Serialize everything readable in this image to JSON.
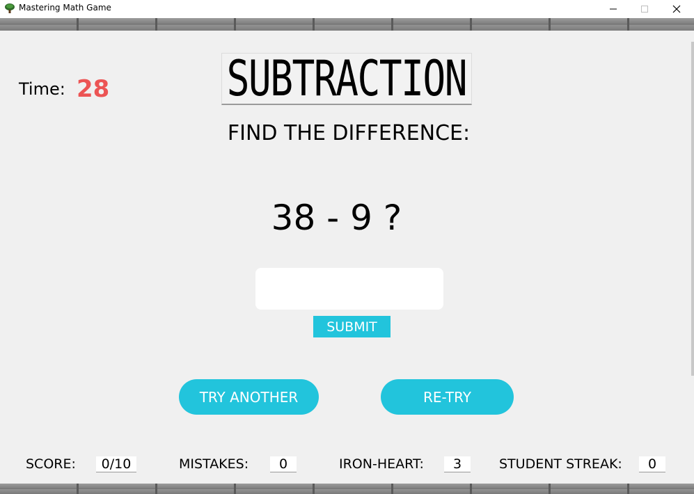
{
  "window": {
    "title": "Mastering Math Game",
    "icon": "tree-icon",
    "controls": [
      "minimize",
      "maximize",
      "close"
    ]
  },
  "timer": {
    "label": "Time:",
    "value": "28",
    "color": "#ec5454"
  },
  "header": {
    "title": "SUBTRACTION",
    "subtitle": "FIND THE DIFFERENCE:"
  },
  "question": {
    "text": "38 - 9 ?"
  },
  "answer": {
    "value": "",
    "placeholder": ""
  },
  "buttons": {
    "submit": "SUBMIT",
    "try_another": "TRY ANOTHER",
    "retry": "RE-TRY"
  },
  "stats": {
    "score_label": "SCORE:",
    "score_value": "0/10",
    "mistakes_label": "MISTAKES:",
    "mistakes_value": "0",
    "iron_heart_label": "IRON-HEART:",
    "iron_heart_value": "3",
    "streak_label": "STUDENT STREAK:",
    "streak_value": "0"
  },
  "colors": {
    "accent": "#22c4dc",
    "timer": "#ec5454",
    "background": "#f0f0f0"
  }
}
